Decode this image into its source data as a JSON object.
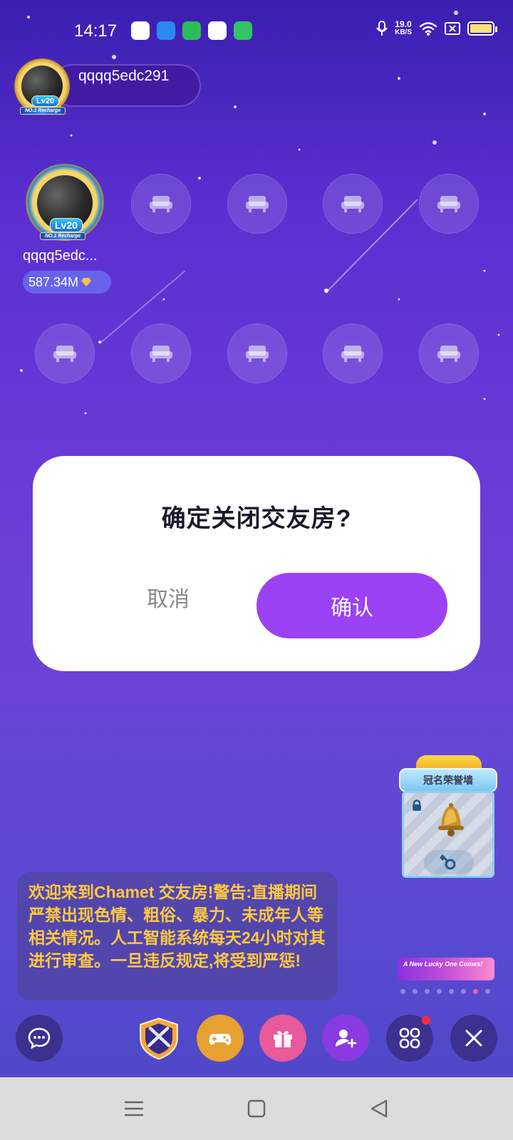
{
  "status_bar": {
    "time": "14:17",
    "net_speed_value": "19.0",
    "net_speed_unit": "KB/S"
  },
  "host": {
    "name": "qqqq5edc291",
    "level": "Lv20",
    "ribbon": "NO.1 Recharge"
  },
  "seats": {
    "occupied": {
      "name": "qqqq5edc...",
      "level": "Lv20",
      "ribbon": "NO.1 Recharge",
      "coins": "587.34M"
    }
  },
  "dialog": {
    "title": "确定关闭交友房?",
    "cancel_label": "取消",
    "confirm_label": "确认"
  },
  "honor_wall": {
    "title": "冠名荣誉墙"
  },
  "lucky_banner": {
    "text": "A New Lucky One Comes!"
  },
  "welcome_message": "欢迎来到Chamet 交友房!警告:直播期间严禁出现色情、粗俗、暴力、未成年人等相关情况。人工智能系统每天24小时对其进行审查。一旦违反规定,将受到严惩!",
  "colors": {
    "accent": "#9b42f5",
    "warning_text": "#ffc940",
    "game_button": "#e8a030",
    "gift_button": "#e85a9a",
    "invite_button": "#8a3ae0"
  },
  "icons": {
    "chat": "chat-bubble-icon",
    "battle": "battle-shield-icon",
    "game": "gamepad-icon",
    "gift": "gift-icon",
    "invite": "add-user-icon",
    "more": "apps-grid-icon",
    "close": "close-icon"
  }
}
